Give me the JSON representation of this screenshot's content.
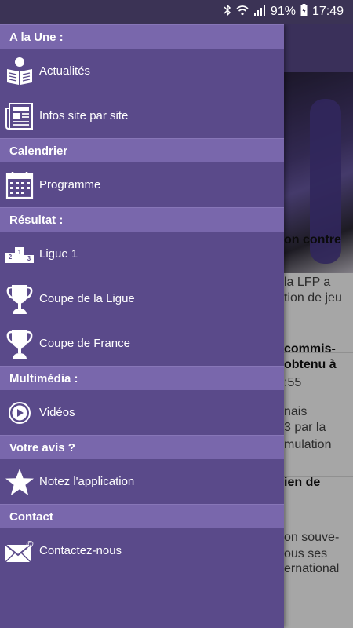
{
  "status_bar": {
    "battery": "91%",
    "time": "17:49"
  },
  "background_page": {
    "lines": [
      {
        "text": "on contre",
        "bold": true
      },
      {
        "text": "la LFP a",
        "bold": false
      },
      {
        "text": "tion de jeu",
        "bold": false
      },
      {
        "text": "commis-",
        "bold": true
      },
      {
        "text": "obtenu à",
        "bold": true
      },
      {
        "text": ":55",
        "bold": false
      },
      {
        "text": "nais",
        "bold": false
      },
      {
        "text": "3 par la",
        "bold": false
      },
      {
        "text": "mulation",
        "bold": false
      },
      {
        "text": "ien de",
        "bold": true
      },
      {
        "text": "on souve-",
        "bold": false
      },
      {
        "text": "ous ses",
        "bold": false
      },
      {
        "text": "ernational",
        "bold": false
      }
    ]
  },
  "drawer": {
    "sections": [
      {
        "header": "A la Une :",
        "items": [
          {
            "label": "Actualités",
            "icon": "reader-icon"
          },
          {
            "label": "Infos site par site",
            "icon": "newspaper-icon"
          }
        ]
      },
      {
        "header": "Calendrier",
        "items": [
          {
            "label": "Programme",
            "icon": "calendar-icon"
          }
        ]
      },
      {
        "header": "Résultat :",
        "items": [
          {
            "label": "Ligue 1",
            "icon": "podium-icon"
          },
          {
            "label": "Coupe de la Ligue",
            "icon": "trophy-icon"
          },
          {
            "label": "Coupe de France",
            "icon": "trophy-icon"
          }
        ]
      },
      {
        "header": "Multimédia :",
        "items": [
          {
            "label": "Vidéos",
            "icon": "play-icon"
          }
        ]
      },
      {
        "header": "Votre avis ?",
        "items": [
          {
            "label": "Notez l'application",
            "icon": "star-icon"
          }
        ]
      },
      {
        "header": "Contact",
        "items": [
          {
            "label": "Contactez-nous",
            "icon": "mail-icon"
          }
        ]
      }
    ]
  }
}
